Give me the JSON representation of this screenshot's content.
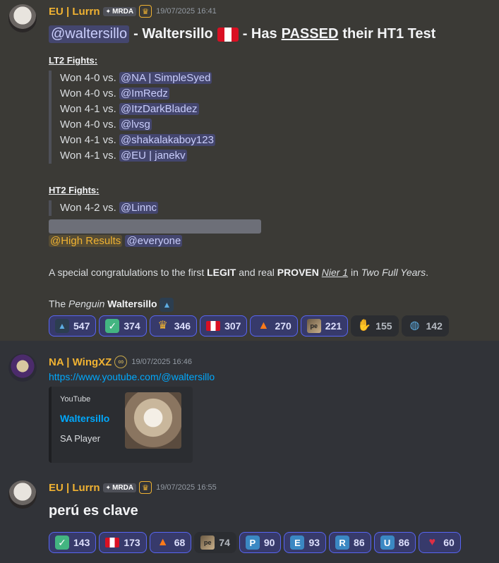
{
  "messages": [
    {
      "username": "EU | Lurrn",
      "tag": "MRDA",
      "timestamp": "19/07/2025 16:41",
      "heading": {
        "mention": "@waltersillo",
        "part1": "- Waltersillo",
        "part2": "- Has",
        "passed": "PASSED",
        "part3": "their HT1 Test"
      },
      "lt2_title": "LT2 Fights:",
      "lt2": [
        {
          "result": "Won 4-0 vs.",
          "opponent": "@NA | SimpleSyed"
        },
        {
          "result": "Won 4-0 vs.",
          "opponent": "@ImRedz"
        },
        {
          "result": "Won 4-1 vs.",
          "opponent": "@ItzDarkBladez"
        },
        {
          "result": "Won 4-0 vs.",
          "opponent": "@lvsg"
        },
        {
          "result": "Won 4-1 vs.",
          "opponent": "@shakalakaboy123"
        },
        {
          "result": "Won 4-1 vs.",
          "opponent": "@EU | janekv"
        }
      ],
      "ht2_title": "HT2 Fights:",
      "ht2": [
        {
          "result": "Won 4-2 vs.",
          "opponent": "@Linnc"
        }
      ],
      "role_mention": "@High Results",
      "everyone_mention": "@everyone",
      "congrats": {
        "a": "A special congratulations to the first",
        "legit": "LEGIT",
        "b": "and real",
        "proven": "PROVEN",
        "nier": "Nier 1",
        "c": "in",
        "years": "Two Full Years",
        "d": "."
      },
      "signoff": {
        "the": "The",
        "penguin": "Penguin",
        "name": "Waltersillo"
      },
      "reactions": [
        {
          "icon": "graduation-cap",
          "count": "547",
          "me": true
        },
        {
          "icon": "check-mark",
          "count": "374",
          "me": true
        },
        {
          "icon": "crown",
          "count": "346",
          "me": true
        },
        {
          "icon": "peru-flag",
          "count": "307",
          "me": true
        },
        {
          "icon": "fire",
          "count": "270",
          "me": true
        },
        {
          "icon": "pe-image",
          "count": "221",
          "me": true
        },
        {
          "icon": "thumbs-up",
          "count": "155",
          "me": false
        },
        {
          "icon": "globe",
          "count": "142",
          "me": false
        }
      ]
    },
    {
      "username": "NA | WingXZ",
      "timestamp": "19/07/2025 16:46",
      "link": "https://www.youtube.com/@waltersillo",
      "embed": {
        "provider": "YouTube",
        "title": "Waltersillo",
        "description": "SA Player"
      }
    },
    {
      "username": "EU | Lurrn",
      "tag": "MRDA",
      "timestamp": "19/07/2025 16:55",
      "text": "perú es clave",
      "reactions": [
        {
          "icon": "check-mark",
          "count": "143",
          "me": true
        },
        {
          "icon": "peru-flag",
          "count": "173",
          "me": true
        },
        {
          "icon": "fire",
          "count": "68",
          "me": true
        },
        {
          "icon": "pe-image",
          "count": "74",
          "me": false
        },
        {
          "icon": "letter-p",
          "letter": "P",
          "count": "90",
          "me": true
        },
        {
          "icon": "letter-e",
          "letter": "E",
          "count": "93",
          "me": true
        },
        {
          "icon": "letter-r",
          "letter": "R",
          "count": "86",
          "me": true
        },
        {
          "icon": "letter-u",
          "letter": "U",
          "count": "86",
          "me": true
        },
        {
          "icon": "heart",
          "count": "60",
          "me": true
        }
      ]
    }
  ],
  "colors": {
    "username": "#f0b232",
    "link": "#00a8fc",
    "mention": "#c9cdfb",
    "highlight_bg": "#3b3a36"
  }
}
